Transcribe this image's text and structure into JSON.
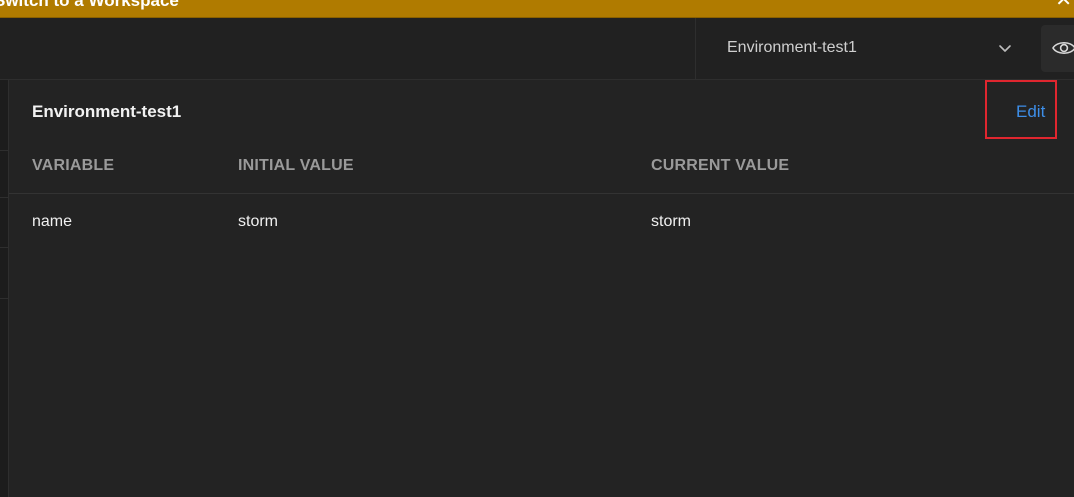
{
  "banner": {
    "text": "Switch to a Workspace",
    "close_glyph": "✕"
  },
  "header": {
    "environment_selected": "Environment-test1",
    "chevron_icon": "chevron-down-icon",
    "eye_icon": "eye-icon"
  },
  "panel": {
    "title": "Environment-test1",
    "edit_label": "Edit",
    "columns": {
      "variable": "VARIABLE",
      "initial": "INITIAL VALUE",
      "current": "CURRENT VALUE"
    },
    "rows": [
      {
        "variable": "name",
        "initial": "storm",
        "current": "storm"
      }
    ]
  },
  "colors": {
    "banner": "#b07b00",
    "link": "#3d8ee8",
    "highlight_box": "#e0262f"
  }
}
